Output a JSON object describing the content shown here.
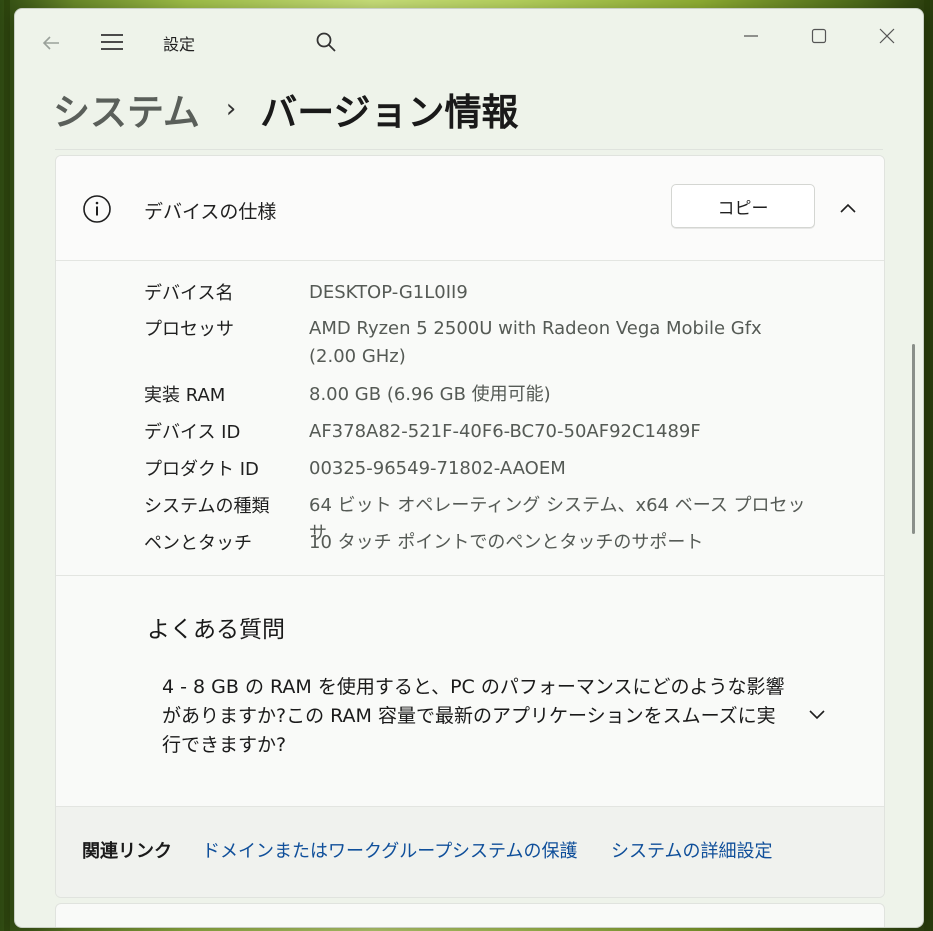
{
  "window": {
    "app_title": "設定",
    "icons": {
      "back": "back-arrow-icon",
      "menu": "hamburger-menu-icon",
      "search": "search-icon",
      "minimize": "minimize-icon",
      "maximize": "maximize-icon",
      "close": "close-icon"
    }
  },
  "breadcrumb": {
    "parent": "システム",
    "separator": "›",
    "current": "バージョン情報"
  },
  "device_specs": {
    "title": "デバイスの仕様",
    "copy_label": "コピー",
    "rows": [
      {
        "label": "デバイス名",
        "value": "DESKTOP-G1L0II9"
      },
      {
        "label": "プロセッサ",
        "value": "AMD Ryzen 5 2500U with Radeon Vega Mobile Gfx (2.00 GHz)"
      },
      {
        "label": "実装 RAM",
        "value": "8.00 GB (6.96 GB 使用可能)"
      },
      {
        "label": "デバイス ID",
        "value": "AF378A82-521F-40F6-BC70-50AF92C1489F"
      },
      {
        "label": "プロダクト ID",
        "value": "00325-96549-71802-AAOEM"
      },
      {
        "label": "システムの種類",
        "value": "64 ビット オペレーティング システム、x64 ベース プロセッサ"
      },
      {
        "label": "ペンとタッチ",
        "value": "10 タッチ ポイントでのペンとタッチのサポート"
      }
    ]
  },
  "faq": {
    "title": "よくある質問",
    "question": "4 - 8 GB の RAM を使用すると、PC のパフォーマンスにどのような影響がありますか?この RAM 容量で最新のアプリケーションをスムーズに実行できますか?"
  },
  "related_links": {
    "title": "関連リンク",
    "links": [
      "ドメインまたはワークグループ",
      "システムの保護",
      "システムの詳細設定"
    ]
  },
  "colors": {
    "link": "#0f4f9a",
    "window_bg": "#eef3ea",
    "card_bg": "#f9faf8"
  }
}
